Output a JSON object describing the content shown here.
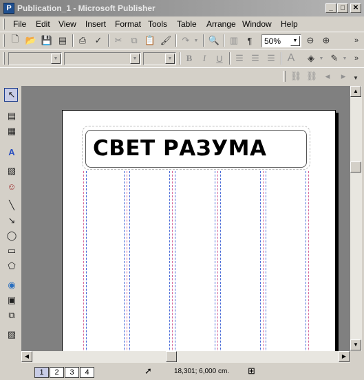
{
  "window": {
    "title": "Publication_1 - Microsoft Publisher",
    "minimize": "_",
    "maximize": "□",
    "close": "✕"
  },
  "menu": {
    "items": [
      {
        "label": "File"
      },
      {
        "label": "Edit"
      },
      {
        "label": "View"
      },
      {
        "label": "Insert"
      },
      {
        "label": "Format"
      },
      {
        "label": "Tools"
      },
      {
        "label": "Table"
      },
      {
        "label": "Arrange"
      },
      {
        "label": "Window"
      },
      {
        "label": "Help"
      }
    ]
  },
  "standard_toolbar": {
    "zoom_value": "50%"
  },
  "formatting_toolbar": {
    "bold": "B",
    "italic": "I",
    "underline": "U",
    "font_size_icon": "A"
  },
  "document": {
    "headline": "СВЕТ РАЗУМА"
  },
  "status": {
    "pages": [
      "1",
      "2",
      "3",
      "4"
    ],
    "active_page": "1",
    "coordinates": "18,301; 6,000 cm."
  },
  "icons": {
    "new": "new-document-icon",
    "open": "open-folder-icon",
    "save": "save-icon",
    "print": "printer-icon",
    "zoom_in": "zoom-in-icon",
    "zoom_out": "zoom-out-icon",
    "pointer": "arrow-pointer-icon"
  },
  "colors": {
    "titlebar_inactive": "#808080",
    "guide_blue": "#4a6cd8",
    "guide_pink": "#d86a9a",
    "workspace": "#808080"
  }
}
